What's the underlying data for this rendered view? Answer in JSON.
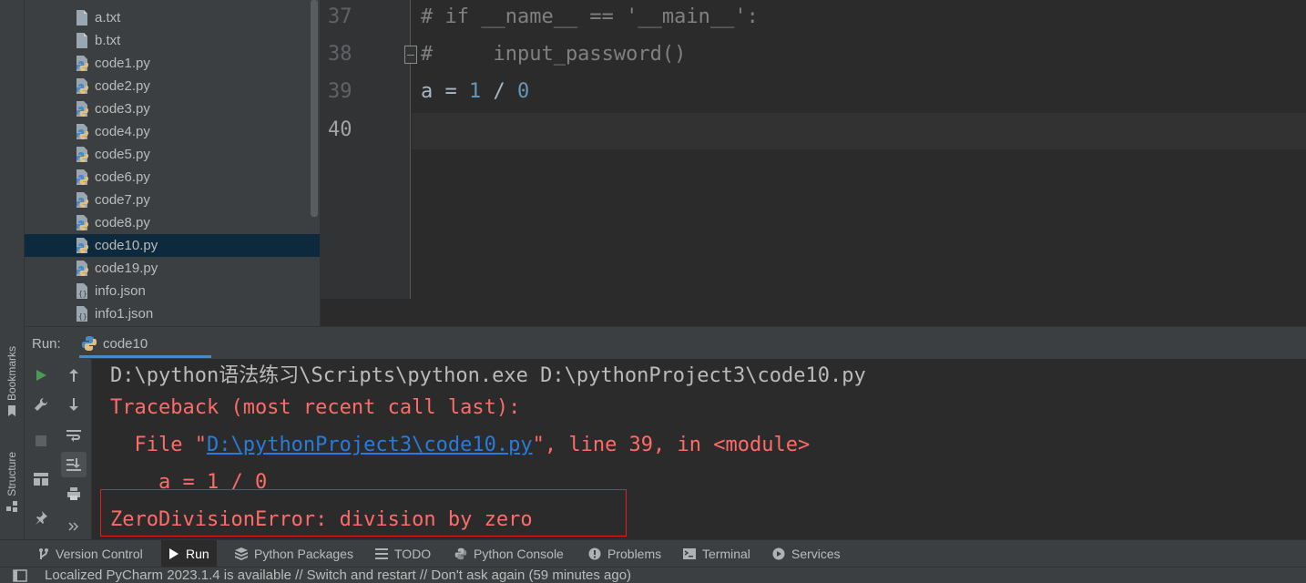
{
  "side_tabs": {
    "bookmarks": "Bookmarks",
    "structure": "Structure"
  },
  "project_tree": {
    "items": [
      {
        "name": "a.txt",
        "icon": "text-file-icon"
      },
      {
        "name": "b.txt",
        "icon": "text-file-icon"
      },
      {
        "name": "code1.py",
        "icon": "python-file-icon"
      },
      {
        "name": "code2.py",
        "icon": "python-file-icon"
      },
      {
        "name": "code3.py",
        "icon": "python-file-icon"
      },
      {
        "name": "code4.py",
        "icon": "python-file-icon"
      },
      {
        "name": "code5.py",
        "icon": "python-file-icon"
      },
      {
        "name": "code6.py",
        "icon": "python-file-icon"
      },
      {
        "name": "code7.py",
        "icon": "python-file-icon"
      },
      {
        "name": "code8.py",
        "icon": "python-file-icon"
      },
      {
        "name": "code10.py",
        "icon": "python-file-icon",
        "selected": true
      },
      {
        "name": "code19.py",
        "icon": "python-file-icon"
      },
      {
        "name": "info.json",
        "icon": "json-file-icon"
      },
      {
        "name": "info1.json",
        "icon": "json-file-icon"
      }
    ]
  },
  "editor": {
    "lines": [
      {
        "number": "37",
        "comment": "# if __name__ == '__main__':"
      },
      {
        "number": "38",
        "comment": "#     input_password()"
      },
      {
        "number": "39",
        "var": "a",
        "eq": " = ",
        "n1": "1",
        "op": " / ",
        "n2": "0"
      },
      {
        "number": "40"
      }
    ]
  },
  "run_panel": {
    "label": "Run:",
    "tab_name": "code10",
    "console": {
      "command": "D:\\python语法练习\\Scripts\\python.exe D:\\pythonProject3\\code10.py",
      "traceback": "Traceback (most recent call last):",
      "file_prefix": "  File \"",
      "file_link": "D:\\pythonProject3\\code10.py",
      "file_suffix": "\", line 39, in <module>",
      "code_line": "    a = 1 / 0",
      "error": "ZeroDivisionError: division by zero"
    }
  },
  "bottom_tabs": [
    {
      "label": "Version Control",
      "icon": "version-control-icon"
    },
    {
      "label": "Run",
      "icon": "run-icon",
      "active": true
    },
    {
      "label": "Python Packages",
      "icon": "python-packages-icon"
    },
    {
      "label": "TODO",
      "icon": "todo-icon"
    },
    {
      "label": "Python Console",
      "icon": "python-console-icon"
    },
    {
      "label": "Problems",
      "icon": "problems-icon"
    },
    {
      "label": "Terminal",
      "icon": "terminal-icon"
    },
    {
      "label": "Services",
      "icon": "services-icon"
    }
  ],
  "status_bar": {
    "message": "Localized PyCharm 2023.1.4 is available // Switch and restart // Don't ask again (59 minutes ago)"
  },
  "colors": {
    "error_text": "#ff6b68",
    "link": "#287bde",
    "selection": "#0d293e",
    "highlight_box": "#e02020"
  }
}
